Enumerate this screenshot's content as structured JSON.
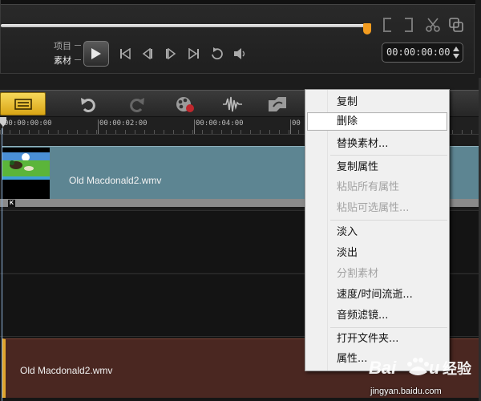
{
  "player": {
    "mode_project": "项目",
    "mode_clip": "素材",
    "timecode": "00:00:00:00",
    "accent_color": "#f39c1f"
  },
  "toolbar": {
    "icons": [
      "storyboard-view-icon",
      "undo-icon",
      "redo-icon",
      "record-capture-icon",
      "sound-mixer-icon",
      "auto-music-icon"
    ]
  },
  "ruler": {
    "labels": [
      "00:00:00:00",
      "00:00:02:00",
      "00:00:04:00",
      "00"
    ]
  },
  "timeline": {
    "video_clip_name": "Old Macdonald2.wmv",
    "audio_clip_name": "Old Macdonald2.wmv",
    "keyframe_badge": "K",
    "video_clip_color": "#5d8592",
    "audio_clip_color": "#4a2721"
  },
  "context_menu": {
    "items": [
      {
        "label": "复制",
        "enabled": true
      },
      {
        "label": "删除",
        "enabled": true,
        "highlighted": true
      },
      {
        "label": "替换素材...",
        "enabled": true
      },
      {
        "label": "复制属性",
        "enabled": true
      },
      {
        "label": "粘贴所有属性",
        "enabled": false
      },
      {
        "label": "粘贴可选属性...",
        "enabled": false
      },
      {
        "label": "淡入",
        "enabled": true
      },
      {
        "label": "淡出",
        "enabled": true
      },
      {
        "label": "分割素材",
        "enabled": false
      },
      {
        "label": "速度/时间流逝...",
        "enabled": true
      },
      {
        "label": "音频滤镜...",
        "enabled": true
      },
      {
        "label": "打开文件夹...",
        "enabled": true
      },
      {
        "label": "属性...",
        "enabled": true
      }
    ]
  },
  "watermark": {
    "brand": "Baidu经验",
    "url": "jingyan.baidu.com"
  }
}
